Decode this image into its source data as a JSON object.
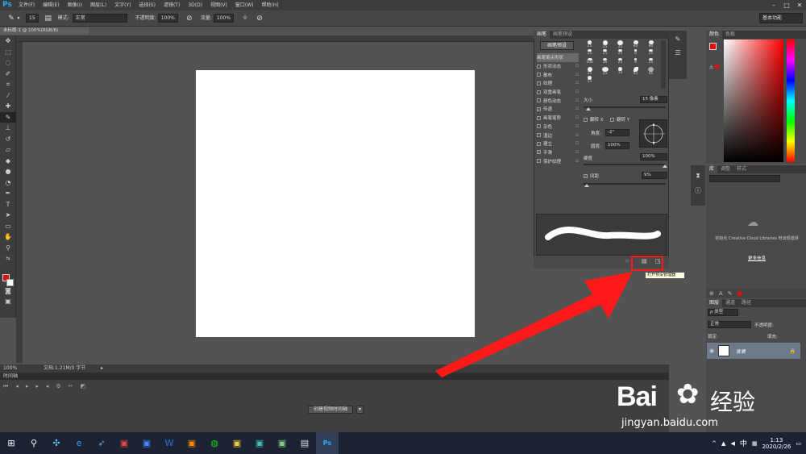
{
  "app": {
    "logo": "Ps"
  },
  "menu": [
    "文件(F)",
    "编辑(E)",
    "图像(I)",
    "图层(L)",
    "文字(Y)",
    "选择(S)",
    "滤镜(T)",
    "3D(D)",
    "视图(V)",
    "窗口(W)",
    "帮助(H)"
  ],
  "options": {
    "brush_size": "15",
    "mode_label": "模式:",
    "mode_value": "正常",
    "opacity_label": "不透明度:",
    "opacity_value": "100%",
    "flow_label": "流量:",
    "flow_value": "100%"
  },
  "workspace": "基本功能",
  "document": {
    "tab": "未标题-1 @ 100%(RGB/8)",
    "zoom": "100%",
    "doc_info": "文档:1.21M/0 字节"
  },
  "timeline": {
    "tab": "时间轴",
    "button": "创建视频时间轴"
  },
  "brush_panel": {
    "tabs": [
      "画笔",
      "画笔预设"
    ],
    "preset_button": "画笔预设",
    "options": [
      {
        "label": "画笔笔尖形状",
        "checked": false,
        "highlight": true
      },
      {
        "label": "形状动态",
        "checked": false
      },
      {
        "label": "散布",
        "checked": false
      },
      {
        "label": "纹理",
        "checked": false
      },
      {
        "label": "双重画笔",
        "checked": false
      },
      {
        "label": "颜色动态",
        "checked": false
      },
      {
        "label": "传递",
        "checked": true
      },
      {
        "label": "画笔笔势",
        "checked": false
      },
      {
        "label": "杂色",
        "checked": false
      },
      {
        "label": "湿边",
        "checked": false
      },
      {
        "label": "建立",
        "checked": false
      },
      {
        "label": "平滑",
        "checked": true
      },
      {
        "label": "保护纹理",
        "checked": false
      }
    ],
    "tip_sizes": [
      "25",
      "25",
      "35",
      "80",
      "80",
      "25",
      "25",
      "25",
      "8",
      "25",
      "100",
      "36",
      "25",
      "8",
      "25",
      "25",
      "25",
      "10",
      "45",
      "45",
      "13"
    ],
    "size_label": "大小",
    "size_value": "15 像素",
    "flip_x": "翻转 X",
    "flip_y": "翻转 Y",
    "angle_label": "角度:",
    "angle_value": "-2°",
    "roundness_label": "圆度:",
    "roundness_value": "100%",
    "hardness_label": "硬度",
    "hardness_value": "100%",
    "spacing_label": "间距",
    "spacing_value": "9%"
  },
  "tooltip": "打开预设管理器",
  "color_panel": {
    "tabs": [
      "颜色",
      "色板"
    ]
  },
  "libraries_panel": {
    "tabs": [
      "库",
      "调整",
      "样式"
    ],
    "message": "初始化 Creative Cloud Libraries 时出现错误",
    "more_info": "更多信息"
  },
  "layers_panel": {
    "tabs": [
      "图层",
      "通道",
      "路径"
    ],
    "kind": "ρ 类型",
    "blend": "正常",
    "opacity_label": "不透明度:",
    "lock_label": "锁定:",
    "fill_label": "填充:",
    "layer_name": "背景"
  },
  "watermark": {
    "brand": "Bai",
    "brand2": "经验",
    "url": "jingyan.baidu.com"
  },
  "taskbar": {
    "time": "1:13",
    "date": "2020/2/26",
    "ime": "中"
  }
}
